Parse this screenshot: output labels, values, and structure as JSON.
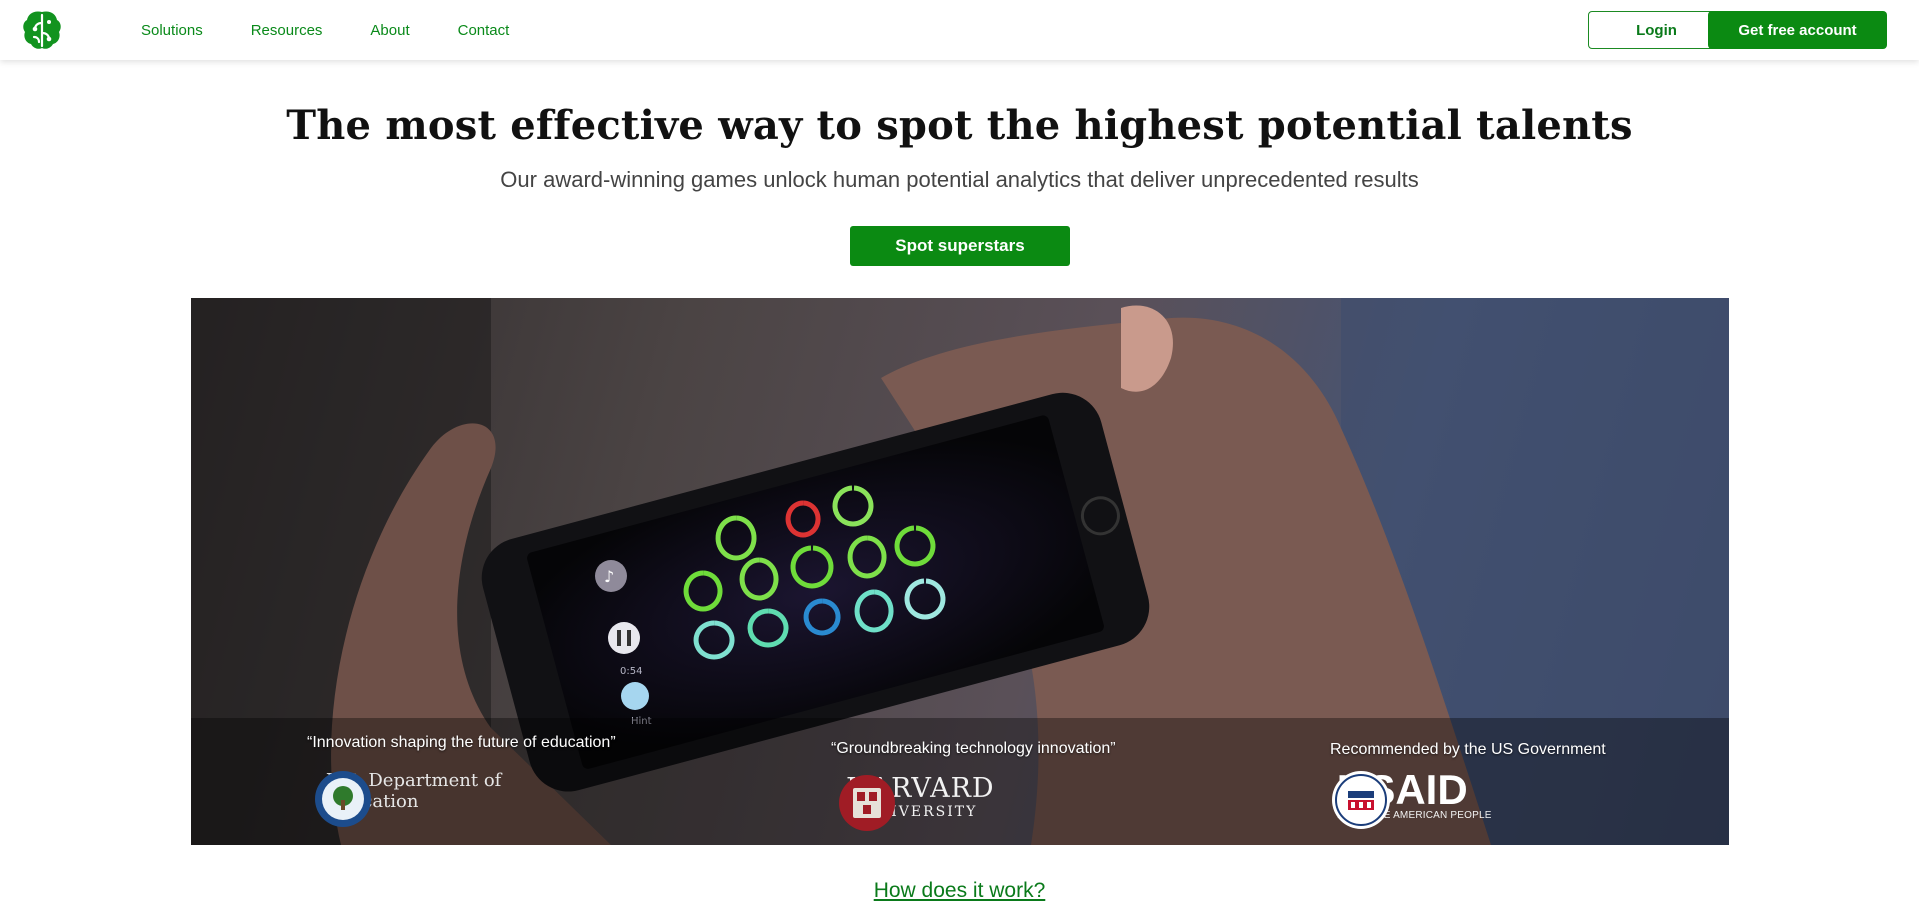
{
  "nav": {
    "links": [
      "Solutions",
      "Resources",
      "About",
      "Contact"
    ],
    "login_label": "Login",
    "signup_label": "Get free account"
  },
  "hero": {
    "headline": "The most effective way to spot the highest potential talents",
    "subheadline": "Our award-winning games unlock human potential analytics that deliver unprecedented results",
    "cta_label": "Spot superstars"
  },
  "game": {
    "timer": "0:54",
    "hint_label": "Hint"
  },
  "endorsements": [
    {
      "quote": "“Innovation shaping the future of education”",
      "logo_line1": "U.S. Department of",
      "logo_line2": "Education"
    },
    {
      "quote": "“Groundbreaking technology innovation”",
      "logo_line1": "HARVARD",
      "logo_line2": "UNIVERSITY"
    },
    {
      "quote": "Recommended by the US Government",
      "logo_line1": "USAID",
      "logo_line2": "FROM THE AMERICAN PEOPLE"
    }
  ],
  "footer_link": "How does it work?",
  "colors": {
    "brand_green": "#0b8a12",
    "link_green": "#0a8a1a"
  }
}
